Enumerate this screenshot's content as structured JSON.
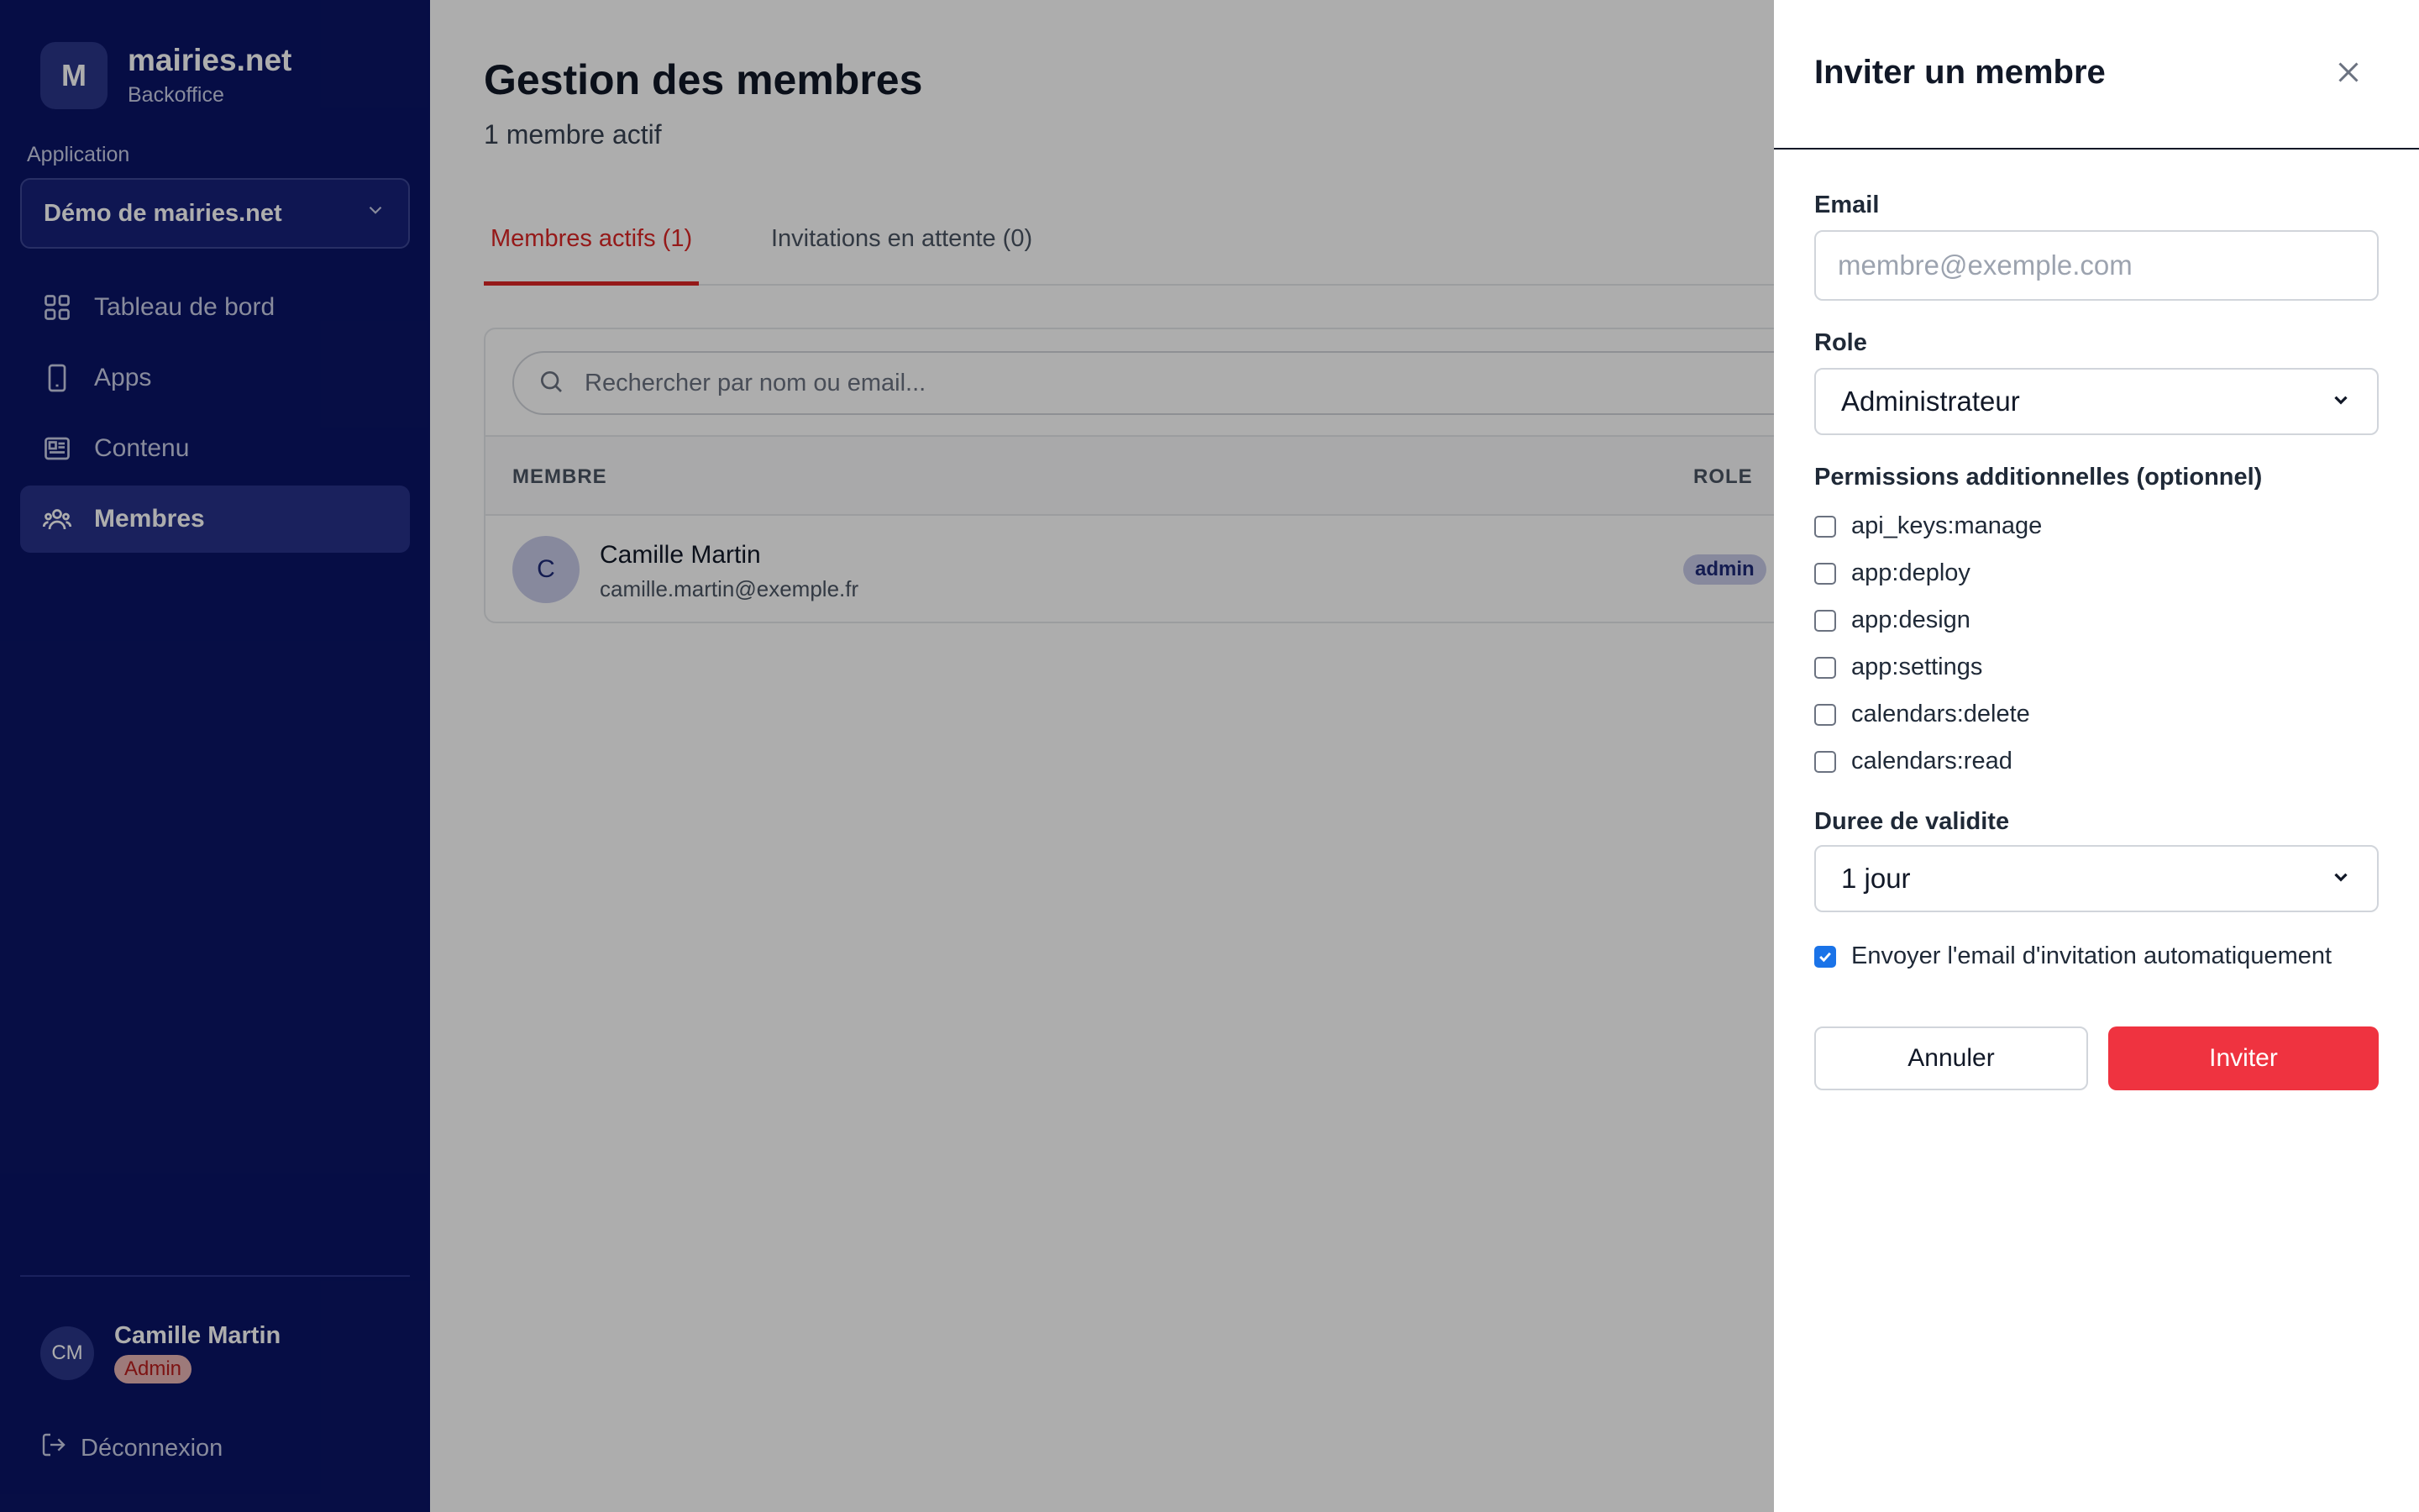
{
  "brand": {
    "initial": "M",
    "name": "mairies.net",
    "subtitle": "Backoffice"
  },
  "sidebar": {
    "application_label": "Application",
    "application_selected": "Démo de mairies.net",
    "items": [
      {
        "label": "Tableau de bord",
        "icon": "grid-icon"
      },
      {
        "label": "Apps",
        "icon": "smartphone-icon"
      },
      {
        "label": "Contenu",
        "icon": "newspaper-icon"
      },
      {
        "label": "Membres",
        "icon": "users-icon",
        "active": true
      }
    ],
    "user": {
      "initials": "CM",
      "name": "Camille Martin",
      "role": "Admin"
    },
    "logout_label": "Déconnexion"
  },
  "main": {
    "title": "Gestion des membres",
    "subtitle": "1 membre actif",
    "tabs": [
      {
        "label": "Membres actifs (1)",
        "active": true
      },
      {
        "label": "Invitations en attente (0)"
      }
    ],
    "search_placeholder": "Rechercher par nom ou email...",
    "columns": [
      "MEMBRE",
      "ROLE"
    ],
    "rows": [
      {
        "initial": "C",
        "name": "Camille Martin",
        "email": "camille.martin@exemple.fr",
        "role": "admin"
      }
    ]
  },
  "drawer": {
    "title": "Inviter un membre",
    "email_label": "Email",
    "email_placeholder": "membre@exemple.com",
    "role_label": "Role",
    "role_value": "Administrateur",
    "permissions_label": "Permissions additionnelles (optionnel)",
    "permissions": [
      {
        "label": "api_keys:manage",
        "checked": false
      },
      {
        "label": "app:deploy",
        "checked": false
      },
      {
        "label": "app:design",
        "checked": false
      },
      {
        "label": "app:settings",
        "checked": false
      },
      {
        "label": "calendars:delete",
        "checked": false
      },
      {
        "label": "calendars:read",
        "checked": false
      }
    ],
    "duration_label": "Duree de validite",
    "duration_value": "1 jour",
    "send_email_label": "Envoyer l'email d'invitation automatiquement",
    "send_email_checked": true,
    "cancel_label": "Annuler",
    "invite_label": "Inviter"
  },
  "colors": {
    "sidebar_bg": "#0a1466",
    "accent_red": "#ef3340",
    "tab_active": "#dc2626",
    "checkbox_blue": "#1a73e8"
  }
}
